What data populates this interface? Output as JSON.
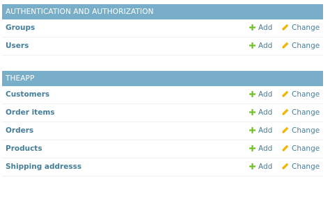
{
  "modules": [
    {
      "caption": "AUTHENTICATION AND AUTHORIZATION",
      "rows": [
        {
          "name": "Groups",
          "add_label": "Add",
          "change_label": "Change"
        },
        {
          "name": "Users",
          "add_label": "Add",
          "change_label": "Change"
        }
      ]
    },
    {
      "caption": "THEAPP",
      "rows": [
        {
          "name": "Customers",
          "add_label": "Add",
          "change_label": "Change"
        },
        {
          "name": "Order items",
          "add_label": "Add",
          "change_label": "Change"
        },
        {
          "name": "Orders",
          "add_label": "Add",
          "change_label": "Change"
        },
        {
          "name": "Products",
          "add_label": "Add",
          "change_label": "Change"
        },
        {
          "name": "Shipping addresss",
          "add_label": "Add",
          "change_label": "Change"
        }
      ]
    }
  ],
  "icons": {
    "add": "plus-icon",
    "change": "pencil-icon"
  },
  "colors": {
    "caption_bg": "#79aec8",
    "link": "#447e9b",
    "add_icon": "#70bf2b",
    "change_icon": "#efb80b"
  }
}
